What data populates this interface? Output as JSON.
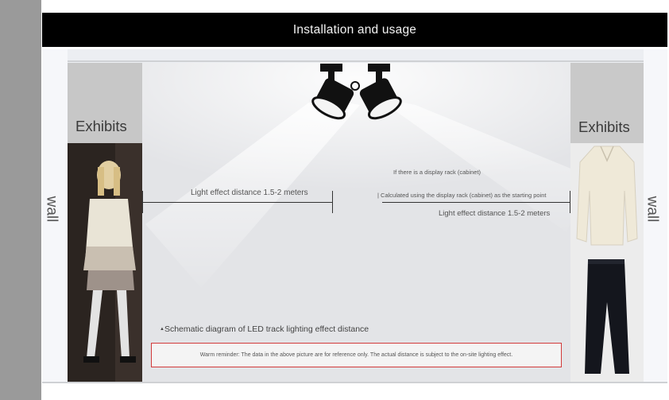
{
  "header": {
    "title": "Installation and usage"
  },
  "walls": {
    "left_label": "wall",
    "right_label": "wall"
  },
  "exhibits": {
    "left_label": "Exhibits",
    "right_label": "Exhibits"
  },
  "measures": {
    "left_distance": "Light effect distance 1.5-2 meters",
    "rack_note": "If there is a display rack (cabinet)",
    "rack_start": "Calculated using the display rack (cabinet) as the starting point",
    "right_distance": "Light effect distance 1.5-2 meters"
  },
  "caption": {
    "marker": "▲",
    "text": "Schematic diagram of LED track lighting effect distance"
  },
  "note": {
    "text": "Warm reminder: The data in the above picture are for reference only. The actual distance is subject to the on-site lighting effect."
  },
  "icons": {
    "light": "track-spotlight-icon",
    "mannequin": "mannequin-icon",
    "blouse": "blouse-icon",
    "trousers": "trousers-icon"
  },
  "colors": {
    "header_bg": "#000000",
    "note_border": "#d23a3a",
    "panel": "#c7c7c7"
  }
}
